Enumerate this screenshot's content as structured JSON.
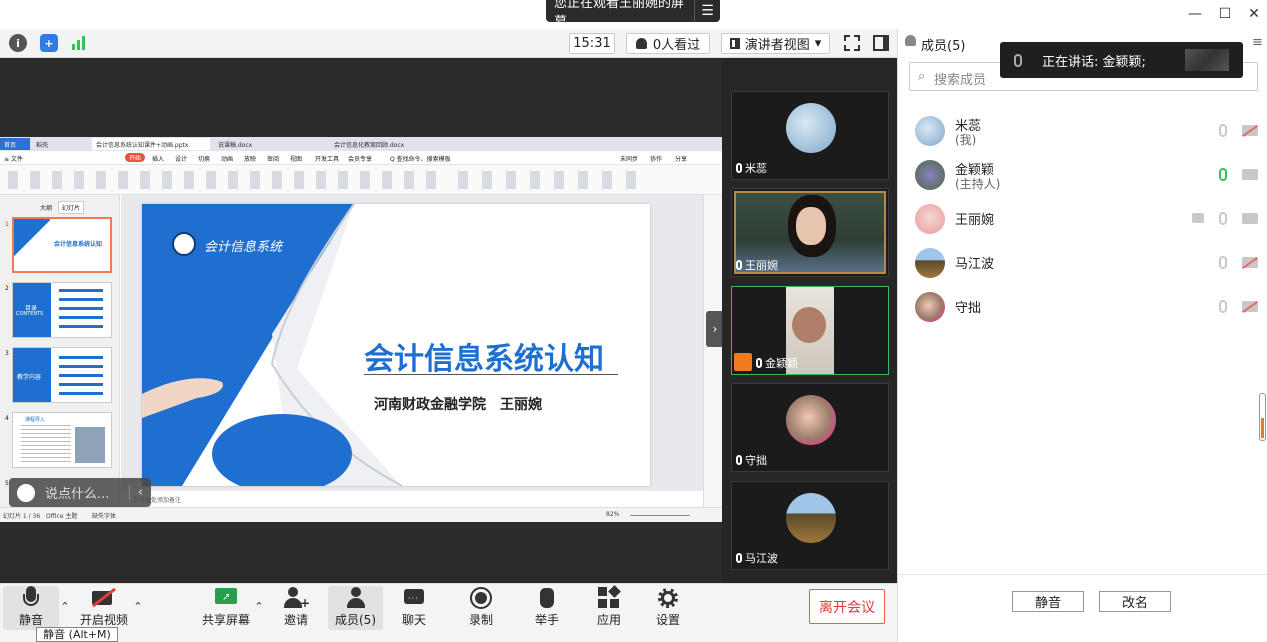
{
  "top_banner": {
    "text": "您正在观看王丽婉的屏幕",
    "menu_icon": "menu-icon"
  },
  "window_controls": {
    "minimize": "—",
    "maximize": "☐",
    "close": "✕"
  },
  "toolbar": {
    "time": "15:31",
    "viewers": "0人看过",
    "view_mode": "演讲者视图",
    "view_caret": "▾"
  },
  "wps": {
    "tabs": [
      "首页",
      "稻壳",
      "会计信息系统认知课件+动画.pptx",
      "说课稿.docx",
      "会计信息化教案回顾.docx"
    ],
    "menu": [
      "≡ 文件",
      "开始",
      "插入",
      "设计",
      "切换",
      "动画",
      "放映",
      "审阅",
      "视图",
      "开发工具",
      "会员专享",
      "Q 查找命令、搜索模板",
      "未同步",
      "协作",
      "分享"
    ],
    "left_tabs": [
      "大纲",
      "幻灯片"
    ],
    "slide_numbers": [
      "1",
      "2",
      "3",
      "4",
      "5"
    ],
    "thumb2_title": "目录",
    "thumb2_sub": "CONTENTS",
    "thumb3_title": "教学内容",
    "thumb4_title": "课程导入",
    "notes_hint": "单击此处添加备注",
    "status_left": "幻灯片 1 / 36",
    "status_theme": "Office 主题",
    "status_font": "缺失字体",
    "status_zoom": "82%"
  },
  "slide": {
    "logo_text": "会计信息系统",
    "title": "会计信息系统认知",
    "subtitle": "河南财政金融学院　王丽婉"
  },
  "chat": {
    "placeholder": "说点什么..."
  },
  "video_tiles": [
    {
      "name": "米蕊"
    },
    {
      "name": "王丽婉"
    },
    {
      "name": "金颖颖"
    },
    {
      "name": "守拙"
    },
    {
      "name": "马江波"
    }
  ],
  "panel": {
    "title": "成员(5)",
    "search_placeholder": "搜索成员",
    "speaking": "正在讲话: 金颖颖;",
    "members": [
      {
        "name": "米蕊",
        "role": "(我)"
      },
      {
        "name": "金颖颖",
        "role": "(主持人)"
      },
      {
        "name": "王丽婉",
        "role": ""
      },
      {
        "name": "马江波",
        "role": ""
      },
      {
        "name": "守拙",
        "role": ""
      }
    ],
    "mute_all": "静音",
    "rename": "改名"
  },
  "bottom": {
    "mute": "静音",
    "video": "开启视频",
    "share": "共享屏幕",
    "invite": "邀请",
    "members": "成员(5)",
    "chat": "聊天",
    "record": "录制",
    "raise_hand": "举手",
    "apps": "应用",
    "settings": "设置",
    "leave": "离开会议",
    "tooltip": "静音 (Alt+M)"
  },
  "colors": {
    "accent_blue": "#1f6fd0",
    "accent_green": "#36c05a",
    "leave_red": "#e03c3c"
  }
}
